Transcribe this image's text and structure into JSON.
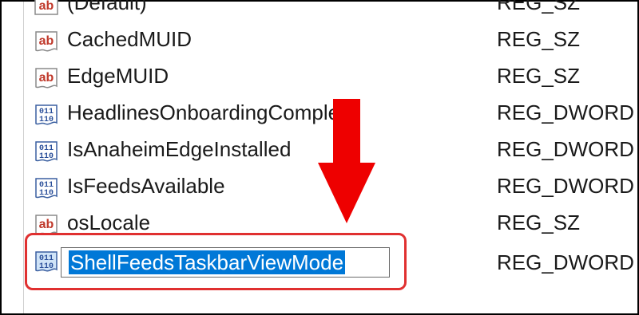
{
  "registry_values": [
    {
      "name": "(Default)",
      "type": "REG_SZ",
      "icon": "reg-sz-icon"
    },
    {
      "name": "CachedMUID",
      "type": "REG_SZ",
      "icon": "reg-sz-icon"
    },
    {
      "name": "EdgeMUID",
      "type": "REG_SZ",
      "icon": "reg-sz-icon"
    },
    {
      "name": "HeadlinesOnboardingComplete",
      "type": "REG_DWORD",
      "icon": "reg-dword-icon"
    },
    {
      "name": "IsAnaheimEdgeInstalled",
      "type": "REG_DWORD",
      "icon": "reg-dword-icon"
    },
    {
      "name": "IsFeedsAvailable",
      "type": "REG_DWORD",
      "icon": "reg-dword-icon"
    },
    {
      "name": "osLocale",
      "type": "REG_SZ",
      "icon": "reg-sz-icon"
    }
  ],
  "editing_row": {
    "name": "ShellFeedsTaskbarViewMode",
    "type": "REG_DWORD",
    "icon": "reg-dword-icon"
  },
  "colors": {
    "selection": "#0078d7",
    "annotation": "#e03030",
    "arrow": "#ee0000"
  }
}
